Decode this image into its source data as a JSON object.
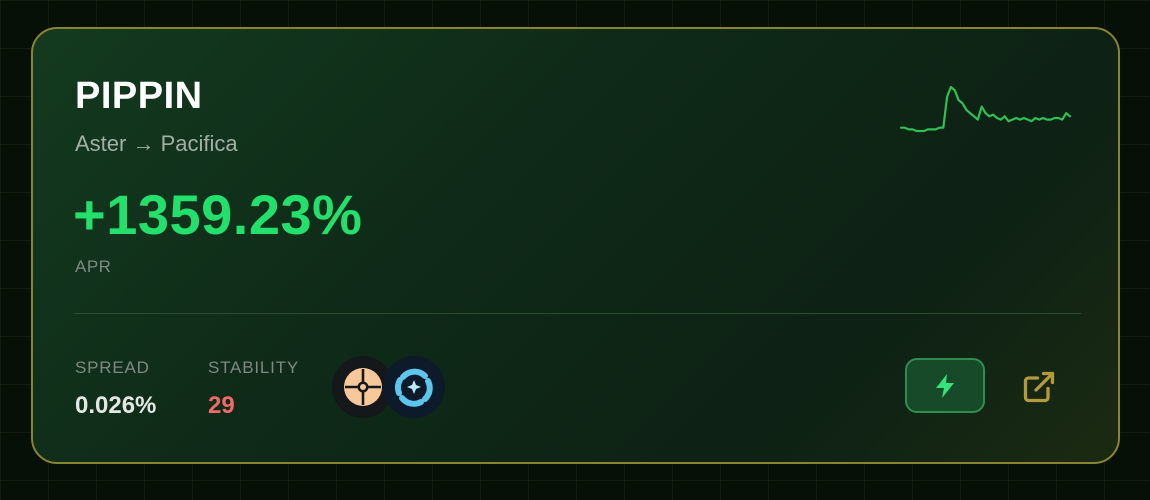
{
  "card": {
    "symbol": "PIPPIN",
    "route": "Aster → Pacifica",
    "apr_value": "+1359.23%",
    "apr_label": "APR",
    "stats": {
      "spread_label": "SPREAD",
      "spread_value": "0.026%",
      "stability_label": "STABILITY",
      "stability_value": "29"
    },
    "exchanges": [
      "Aster",
      "Pacifica"
    ],
    "actions": {
      "bolt_icon": "lightning-bolt-icon",
      "external_icon": "external-link-icon"
    }
  },
  "colors": {
    "apr_positive": "#22e06b",
    "stability_value": "#f06a6a",
    "card_border": "#8a8330",
    "sparkline": "#2fbf55",
    "external_icon": "#b39a3c"
  },
  "sparkline": {
    "values": [
      3,
      3,
      2,
      2,
      1,
      1,
      1,
      2,
      2,
      2,
      3,
      3,
      22,
      28,
      26,
      20,
      18,
      14,
      12,
      10,
      8,
      16,
      12,
      10,
      11,
      9,
      8,
      10,
      7,
      8,
      9,
      8,
      9,
      8,
      7,
      9,
      8,
      9,
      8,
      8,
      9,
      9,
      8,
      12,
      10
    ]
  }
}
